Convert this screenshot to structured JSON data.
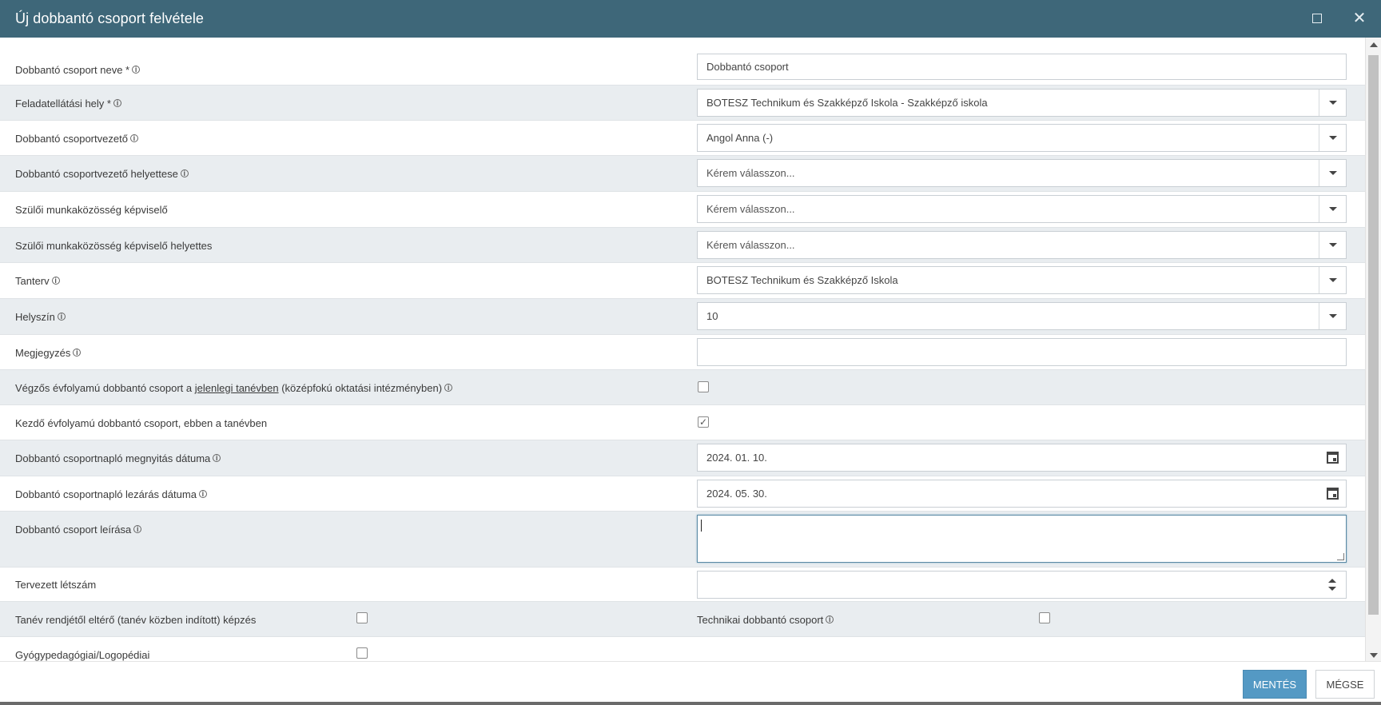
{
  "dialog": {
    "title": "Új dobbantó csoport felvétele"
  },
  "form": {
    "name": {
      "label": "Dobbantó csoport neve *",
      "value": "Dobbantó csoport"
    },
    "site": {
      "label": "Feladatellátási hely *",
      "value": "BOTESZ Technikum és Szakképző Iskola - Szakképző iskola"
    },
    "leader": {
      "label": "Dobbantó csoportvezető",
      "value": "Angol Anna (-)"
    },
    "deputy": {
      "label": "Dobbantó csoportvezető helyettese",
      "value": "Kérem válasszon..."
    },
    "parent_rep": {
      "label": "Szülői munkaközösség képviselő",
      "value": "Kérem válasszon..."
    },
    "parent_rep_deputy": {
      "label": "Szülői munkaközösség képviselő helyettes",
      "value": "Kérem válasszon..."
    },
    "curriculum": {
      "label": "Tanterv",
      "value": "BOTESZ Technikum és Szakképző Iskola"
    },
    "location": {
      "label": "Helyszín",
      "value": "10"
    },
    "note": {
      "label": "Megjegyzés",
      "value": ""
    },
    "final_year": {
      "label_pre": "Végzős évfolyamú dobbantó csoport a ",
      "label_link": "jelenlegi tanévben",
      "label_post": " (középfokú oktatási intézményben)",
      "checked": false
    },
    "starting_year": {
      "label": "Kezdő évfolyamú dobbantó csoport, ebben a tanévben",
      "checked": true,
      "check_mark": "✓"
    },
    "open_date": {
      "label": "Dobbantó csoportnapló megnyitás dátuma",
      "value": "2024. 01. 10."
    },
    "close_date": {
      "label": "Dobbantó csoportnapló lezárás dátuma",
      "value": "2024. 05. 30."
    },
    "description": {
      "label": "Dobbantó csoport leírása",
      "value": ""
    },
    "planned_count": {
      "label": "Tervezett létszám",
      "value": ""
    },
    "irregular_training": {
      "label": "Tanév rendjétől eltérő (tanév közben indított) képzés",
      "checked": false
    },
    "technical_group": {
      "label": "Technikai dobbantó csoport",
      "checked": false
    },
    "special_ed": {
      "label": "Gyógypedagógiai/Logopédiai",
      "checked": false
    }
  },
  "info_glyph": "i",
  "footer": {
    "save_label": "MENTÉS",
    "cancel_label": "MÉGSE"
  },
  "colors": {
    "titlebar": "#3e6779",
    "save_button": "#5499c4",
    "alt_row": "#e9edf0"
  }
}
